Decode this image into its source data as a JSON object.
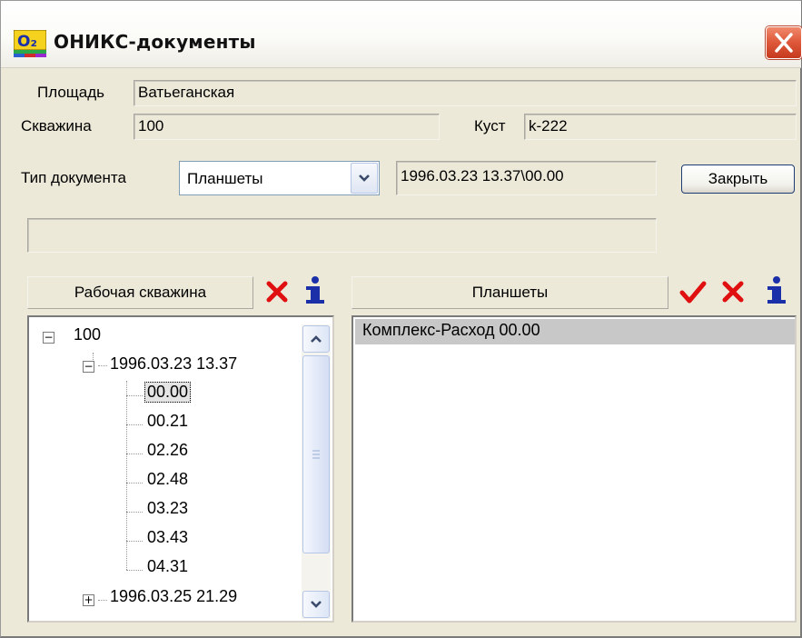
{
  "window": {
    "title": "ОНИКС-документы",
    "app_icon": "O₂"
  },
  "form": {
    "area_label": "Площадь",
    "area_value": "Ватьеганская",
    "well_label": "Скважина",
    "well_value": "100",
    "pad_label": "Куст",
    "pad_value": "k-222",
    "doctype_label": "Тип документа",
    "doctype_value": "Планшеты",
    "doc_path_value": "1996.03.23 13.37\\00.00",
    "close_button": "Закрыть"
  },
  "left_panel": {
    "header": "Рабочая скважина",
    "icons": [
      "delete-icon",
      "info-icon"
    ],
    "tree": {
      "root": "100",
      "group1": "1996.03.23 13.37",
      "children": [
        "00.00",
        "00.21",
        "02.26",
        "02.48",
        "03.23",
        "03.43",
        "04.31"
      ],
      "selected": "00.00",
      "group2": "1996.03.25 21.29"
    }
  },
  "right_panel": {
    "header": "Планшеты",
    "icons": [
      "check-icon",
      "delete-icon",
      "info-icon"
    ],
    "items": [
      "Комплекс-Расход 00.00"
    ]
  },
  "colors": {
    "window_bg": "#ece9d8",
    "close_red": "#e05a3c",
    "delete_red": "#e01010",
    "info_blue": "#1a2fa8",
    "selection": "#c8c8c8"
  }
}
